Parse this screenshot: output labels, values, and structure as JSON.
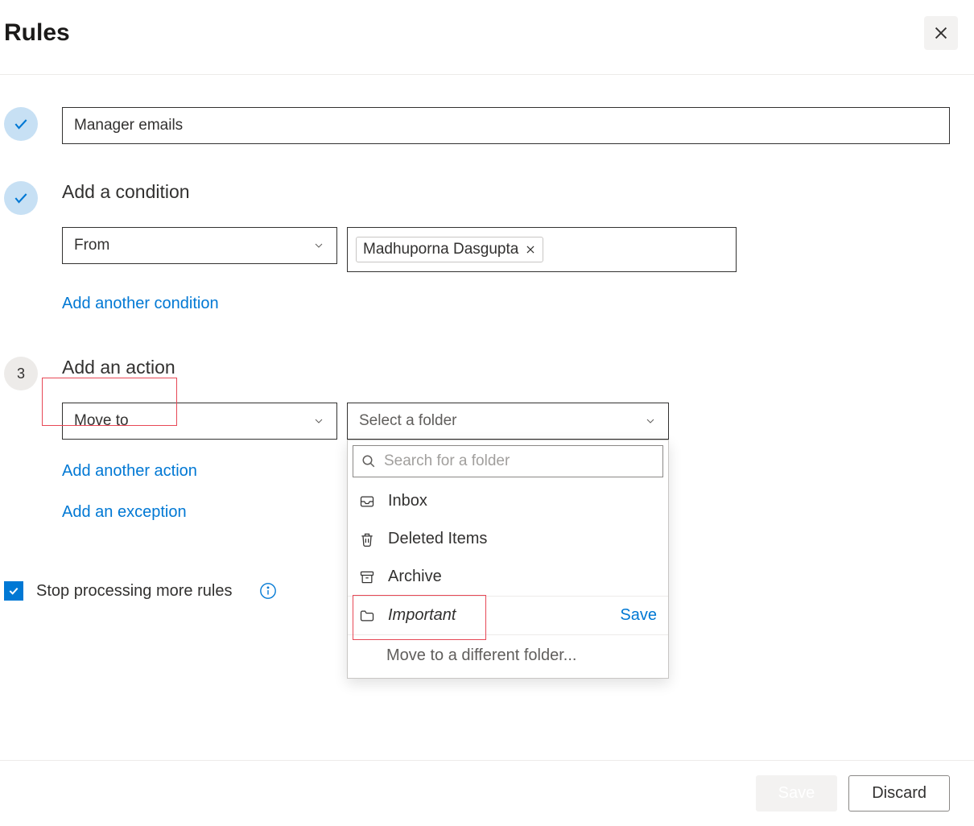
{
  "header": {
    "title": "Rules"
  },
  "step1": {
    "rule_name": "Manager emails"
  },
  "step2": {
    "label": "Add a condition",
    "condition_type": "From",
    "chip_name": "Madhuporna Dasgupta",
    "add_another": "Add another condition"
  },
  "step3": {
    "badge": "3",
    "label": "Add an action",
    "action_type": "Move to",
    "folder_placeholder": "Select a folder",
    "search_placeholder": "Search for a folder",
    "folders": {
      "inbox": "Inbox",
      "deleted": "Deleted Items",
      "archive": "Archive",
      "important": "Important"
    },
    "important_save": "Save",
    "different_folder": "Move to a different folder...",
    "add_another_action": "Add another action",
    "add_exception": "Add an exception"
  },
  "stop_processing": {
    "label": "Stop processing more rules"
  },
  "footer": {
    "save": "Save",
    "discard": "Discard"
  }
}
